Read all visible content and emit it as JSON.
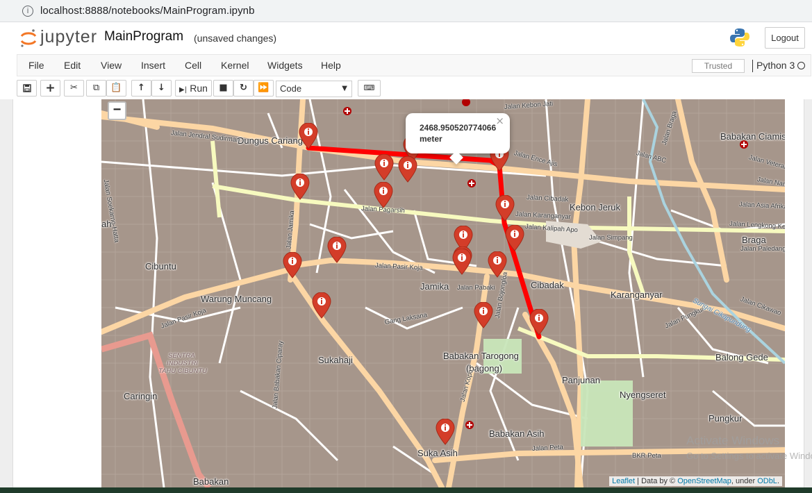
{
  "browser": {
    "url": "localhost:8888/notebooks/MainProgram.ipynb"
  },
  "header": {
    "logo_text": "jupyter",
    "notebook_name": "MainProgram",
    "save_status": "(unsaved changes)",
    "logout_label": "Logout"
  },
  "menubar": {
    "items": [
      "File",
      "Edit",
      "View",
      "Insert",
      "Cell",
      "Kernel",
      "Widgets",
      "Help"
    ],
    "trusted": "Trusted",
    "kernel": "Python 3"
  },
  "toolbar": {
    "run_label": "Run",
    "cell_type": "Code",
    "buttons": [
      "save-icon",
      "add-cell-icon",
      "cut-icon",
      "copy-icon",
      "paste-icon",
      "move-up-icon",
      "move-down-icon",
      "run-icon",
      "stop-icon",
      "restart-icon",
      "fast-forward-icon",
      "keyboard-icon"
    ]
  },
  "map": {
    "zoom_out": "−",
    "popup_text": "2468.950520774066 meter",
    "popup_close": "×",
    "attribution": {
      "leaflet": "Leaflet",
      "data_by": " | Data by © ",
      "osm": "OpenStreetMap",
      "under": ", under ",
      "odbl": "ODbL",
      "end": "."
    },
    "place_labels": [
      "Dungus Cariang",
      "Kebon Jeruk",
      "Babakan Ciamis",
      "Cibuntu",
      "Warung Muncang",
      "Jamika",
      "Cibadak",
      "Karanganyar",
      "Braga",
      "Sukahaji",
      "Babakan Tarogong",
      "(bagong)",
      "Panjunan",
      "Nyengseret",
      "Balong Gede",
      "Caringin",
      "Babakan Asih",
      "Suka Asih",
      "Pungkur",
      "Babakan",
      "ah"
    ],
    "street_labels": [
      "Jalan Jendral Sudirman",
      "Jalan Kebon Jati",
      "Jalan Pagarsih",
      "Jalan Cibadak",
      "Jalan Kalipah Apo",
      "Jalan Pasir Koja",
      "Jalan Asia Afrika",
      "Jalan Lengkong Kecil",
      "Jalan Peta",
      "Jalan Kopo",
      "Jalan Jamika",
      "Jalan Soekarno-Hatta",
      "Jalan Pungkur",
      "Jalan Braga",
      "Jalan ABC",
      "Jalan Veteran",
      "Jalan Nan",
      "Jalan Pasir Koja",
      "Jalan Babakan Ciparay",
      "BKR Peta",
      "Jalan Karanganyar",
      "Jalan Simpang",
      "Jalan Paledang",
      "Jalan Cikawao",
      "Jalan Pabaki",
      "Gang Laksana",
      "Jalan Bojongloa",
      "Jalan Ence Ajis"
    ],
    "industry_label": [
      "SENTRA",
      "INDUSTRI",
      "TAHU CIBUNTU"
    ],
    "river_label": "Sungai Cikapundung"
  },
  "watermark": {
    "line1": "Activate Windows",
    "line2": "Go to Settings to activate Windows."
  },
  "colors": {
    "route": "#ff0000",
    "marker": "#d33d29",
    "road_major": "#fcd6a4",
    "road_minor": "#ffffff",
    "built": "#a6968b"
  }
}
